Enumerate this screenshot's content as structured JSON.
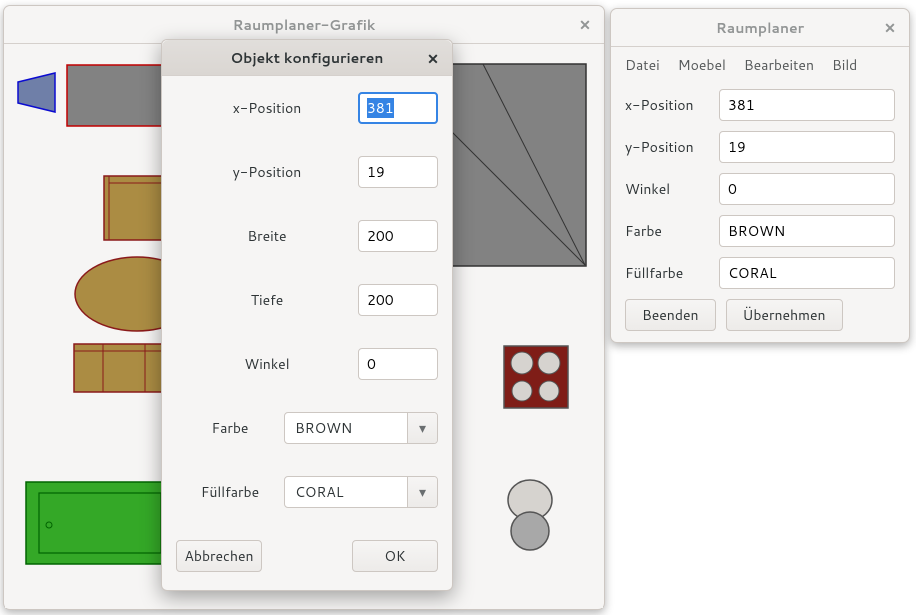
{
  "grafik": {
    "title": "Raumplaner-Grafik"
  },
  "planer": {
    "title": "Raumplaner",
    "menu": {
      "datei": "Datei",
      "moebel": "Moebel",
      "bearbeiten": "Bearbeiten",
      "bild": "Bild"
    },
    "labels": {
      "x": "x-Position",
      "y": "y-Position",
      "winkel": "Winkel",
      "farbe": "Farbe",
      "fuell": "Füllfarbe"
    },
    "values": {
      "x": "381",
      "y": "19",
      "winkel": "0",
      "farbe": "BROWN",
      "fuell": "CORAL"
    },
    "buttons": {
      "beenden": "Beenden",
      "uebernehmen": "Übernehmen"
    }
  },
  "dialog": {
    "title": "Objekt konfigurieren",
    "labels": {
      "x": "x-Position",
      "y": "y-Position",
      "breite": "Breite",
      "tiefe": "Tiefe",
      "winkel": "Winkel",
      "farbe": "Farbe",
      "fuell": "Füllfarbe"
    },
    "values": {
      "x": "381",
      "y": "19",
      "breite": "200",
      "tiefe": "200",
      "winkel": "0",
      "farbe": "BROWN",
      "fuell": "CORAL"
    },
    "buttons": {
      "abbrechen": "Abbrechen",
      "ok": "OK"
    }
  }
}
